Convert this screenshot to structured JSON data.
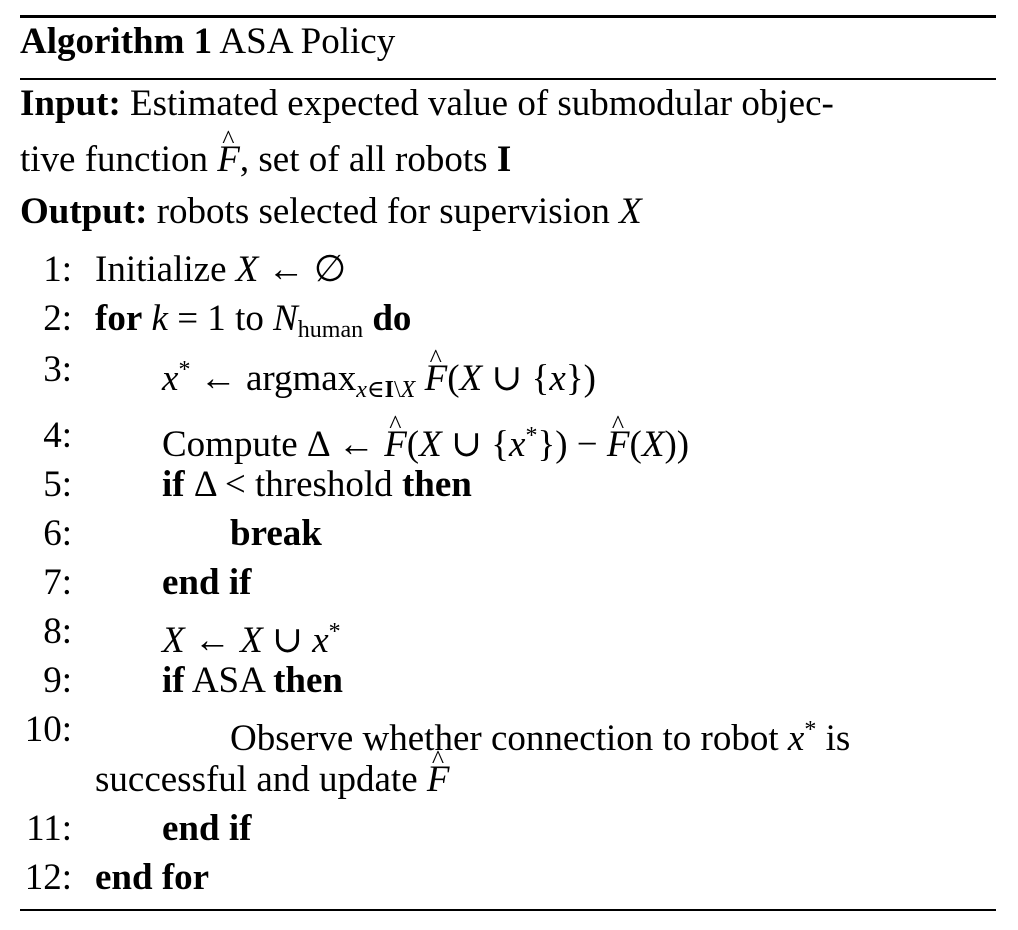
{
  "algorithm": {
    "label": "Algorithm 1",
    "name": "ASA Policy",
    "input_label": "Input:",
    "input_text_1": "Estimated expected value of submodular objec-",
    "input_text_2a": "tive function",
    "input_text_2b": ", set of all robots",
    "output_label": "Output:",
    "output_text": "robots selected for supervision",
    "steps": [
      {
        "n": "1:",
        "kw": "",
        "text": "Initialize"
      },
      {
        "n": "2:",
        "kw": "for",
        "text": "to",
        "kw2": "do",
        "sub": "human"
      },
      {
        "n": "3:",
        "text": "argmax"
      },
      {
        "n": "4:",
        "text": "Compute"
      },
      {
        "n": "5:",
        "kw": "if",
        "text": "threshold",
        "kw2": "then"
      },
      {
        "n": "6:",
        "kw": "break"
      },
      {
        "n": "7:",
        "kw": "end if"
      },
      {
        "n": "8:"
      },
      {
        "n": "9:",
        "kw": "if",
        "text": "ASA",
        "kw2": "then"
      },
      {
        "n": "10:",
        "text": "Observe whether connection to robot",
        "text2": "is",
        "cont": "successful and update"
      },
      {
        "n": "11:",
        "kw": "end if"
      },
      {
        "n": "12:",
        "kw": "end for"
      }
    ]
  }
}
